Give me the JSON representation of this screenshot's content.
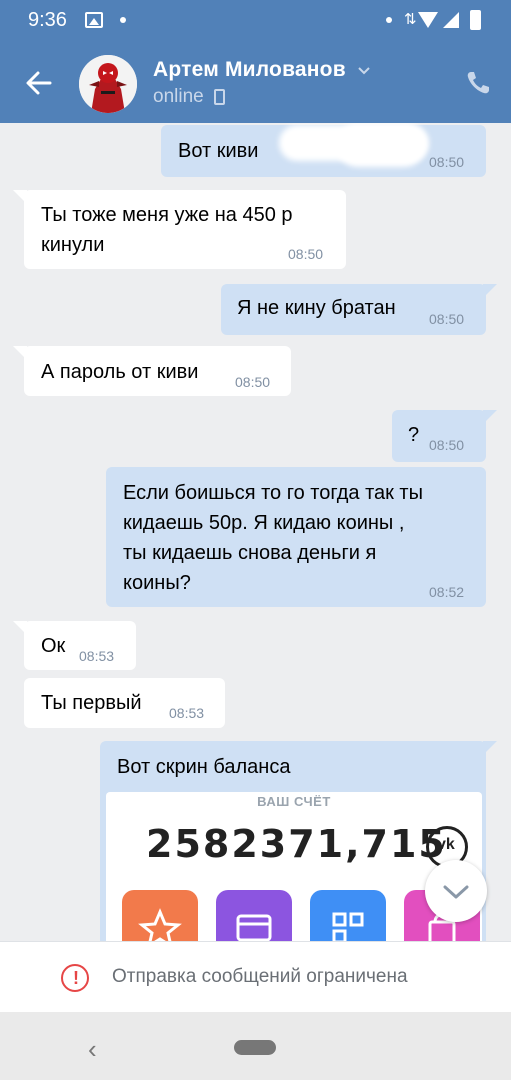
{
  "status_bar": {
    "time": "9:36"
  },
  "header": {
    "title": "Артем Милованов",
    "subtitle": "online"
  },
  "messages": [
    {
      "direction": "out",
      "text": "Вот киви",
      "time": "08:50"
    },
    {
      "direction": "in",
      "text_lines": [
        "Ты тоже меня уже на 450 р",
        "кинули"
      ],
      "time": "08:50"
    },
    {
      "direction": "out",
      "text": "Я не кину братан",
      "time": "08:50"
    },
    {
      "direction": "in",
      "text": "А пароль от киви",
      "time": "08:50"
    },
    {
      "direction": "out",
      "text": "?",
      "time": "08:50"
    },
    {
      "direction": "out",
      "text_lines": [
        "Если боишься то го тогда так ты",
        "кидаешь 50р. Я кидаю коины ,",
        "ты кидаешь снова деньги я",
        "коины?"
      ],
      "time": "08:52"
    },
    {
      "direction": "in",
      "text": "Ок",
      "time": "08:53"
    },
    {
      "direction": "in",
      "text": "Ты первый",
      "time": "08:53"
    },
    {
      "direction": "out",
      "text": "Вот скрин баланса"
    }
  ],
  "balance_screenshot": {
    "caption": "ВАШ СЧЁТ",
    "amount": "2582371,715",
    "icon": "vk-coin-icon",
    "tile_colors": [
      "#f27a4b",
      "#8c55e0",
      "#3f8ff5",
      "#e24fbf"
    ]
  },
  "footer": {
    "notice": "Отправка сообщений ограничена",
    "icon": "warning-icon",
    "icon_color": "#e64646"
  },
  "colors": {
    "header_bg": "#5181b8",
    "outgoing_bubble": "#cfe0f4",
    "incoming_bubble": "#ffffff",
    "chat_bg": "#edeef0"
  }
}
